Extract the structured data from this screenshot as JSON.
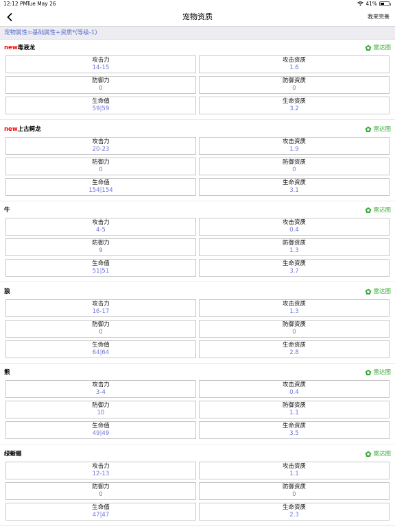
{
  "status_bar": {
    "time": "12:12 PM",
    "date": "Tue May 26",
    "battery": "41%",
    "battery_level": 0.41
  },
  "nav": {
    "back_icon": "chevron-left-icon",
    "title": "宠物资质",
    "right_button": "我来完善"
  },
  "formula": "宠物属性=基础属性+资质*(等级-1)",
  "radar_label": "雷达图",
  "new_badge": "new",
  "colors": {
    "new_badge": "#ff0000",
    "radar": "#3cab3c",
    "value": "#6b73d9",
    "formula": "#5a6fcf"
  },
  "pets": [
    {
      "new": true,
      "name": "毒液龙",
      "left": [
        {
          "label": "攻击力",
          "value": "14-15"
        },
        {
          "label": "防御力",
          "value": "0"
        },
        {
          "label": "生命值",
          "value": "59|59"
        }
      ],
      "right": [
        {
          "label": "攻击资质",
          "value": "1.6"
        },
        {
          "label": "防御资质",
          "value": "0"
        },
        {
          "label": "生命资质",
          "value": "3.2"
        }
      ]
    },
    {
      "new": true,
      "name": "上古鳄龙",
      "left": [
        {
          "label": "攻击力",
          "value": "20-23"
        },
        {
          "label": "防御力",
          "value": "0"
        },
        {
          "label": "生命值",
          "value": "154|154"
        }
      ],
      "right": [
        {
          "label": "攻击资质",
          "value": "1.9"
        },
        {
          "label": "防御资质",
          "value": "0"
        },
        {
          "label": "生命资质",
          "value": "3.1"
        }
      ]
    },
    {
      "new": false,
      "name": "牛",
      "left": [
        {
          "label": "攻击力",
          "value": "4-5"
        },
        {
          "label": "防御力",
          "value": "9"
        },
        {
          "label": "生命值",
          "value": "51|51"
        }
      ],
      "right": [
        {
          "label": "攻击资质",
          "value": "0.4"
        },
        {
          "label": "防御资质",
          "value": "1.3"
        },
        {
          "label": "生命资质",
          "value": "3.7"
        }
      ]
    },
    {
      "new": false,
      "name": "狼",
      "left": [
        {
          "label": "攻击力",
          "value": "16-17"
        },
        {
          "label": "防御力",
          "value": "0"
        },
        {
          "label": "生命值",
          "value": "64|64"
        }
      ],
      "right": [
        {
          "label": "攻击资质",
          "value": "1.3"
        },
        {
          "label": "防御资质",
          "value": "0"
        },
        {
          "label": "生命资质",
          "value": "2.8"
        }
      ]
    },
    {
      "new": false,
      "name": "熊",
      "left": [
        {
          "label": "攻击力",
          "value": "3-4"
        },
        {
          "label": "防御力",
          "value": "10"
        },
        {
          "label": "生命值",
          "value": "49|49"
        }
      ],
      "right": [
        {
          "label": "攻击资质",
          "value": "0.4"
        },
        {
          "label": "防御资质",
          "value": "1.1"
        },
        {
          "label": "生命资质",
          "value": "3.5"
        }
      ]
    },
    {
      "new": false,
      "name": "绿蜥蜴",
      "left": [
        {
          "label": "攻击力",
          "value": "12-13"
        },
        {
          "label": "防御力",
          "value": "0"
        },
        {
          "label": "生命值",
          "value": "47|47"
        }
      ],
      "right": [
        {
          "label": "攻击资质",
          "value": "1.1"
        },
        {
          "label": "防御资质",
          "value": "0"
        },
        {
          "label": "生命资质",
          "value": "2.3"
        }
      ]
    }
  ]
}
